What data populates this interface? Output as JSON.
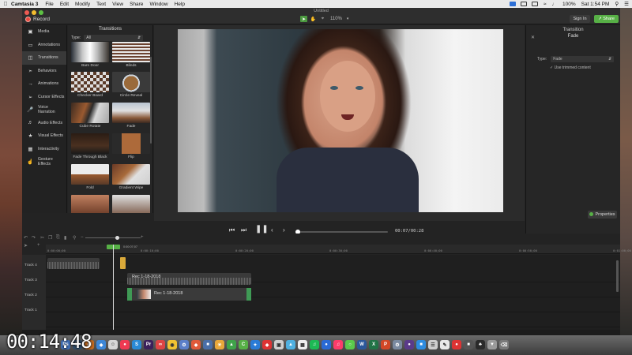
{
  "menubar": {
    "app_name": "Camtasia 3",
    "items": [
      "File",
      "Edit",
      "Modify",
      "Text",
      "View",
      "Share",
      "Window",
      "Help"
    ],
    "clock": "Sat 1:54 PM",
    "battery": "100%"
  },
  "window": {
    "title": "Untitled",
    "record_label": "Record",
    "zoom": "110%",
    "signin_label": "Sign In",
    "share_label": "Share"
  },
  "sidebar": {
    "items": [
      {
        "label": "Media",
        "icon": "film-icon"
      },
      {
        "label": "Annotations",
        "icon": "annotation-icon"
      },
      {
        "label": "Transitions",
        "icon": "transition-icon"
      },
      {
        "label": "Behaviors",
        "icon": "behavior-icon"
      },
      {
        "label": "Animations",
        "icon": "animation-icon"
      },
      {
        "label": "Cursor Effects",
        "icon": "cursor-icon"
      },
      {
        "label": "Voice Narration",
        "icon": "microphone-icon"
      },
      {
        "label": "Audio Effects",
        "icon": "speaker-icon"
      },
      {
        "label": "Visual Effects",
        "icon": "visual-effects-icon"
      },
      {
        "label": "Interactivity",
        "icon": "interactivity-icon"
      },
      {
        "label": "Gesture Effects",
        "icon": "hand-icon"
      }
    ],
    "active_index": 2
  },
  "transitions_panel": {
    "title": "Transitions",
    "type_label": "Type:",
    "type_value": "All",
    "items": [
      "Barn Door",
      "Blinds",
      "Checker Board",
      "Circle Reveal",
      "Cube Rotate",
      "Fade",
      "Fade Through Black",
      "Flip",
      "Fold",
      "Gradient Wipe"
    ]
  },
  "properties": {
    "header": "Transition",
    "name": "Fade",
    "type_label": "Type:",
    "type_value": "Fade",
    "checkbox_label": "Use trimmed content",
    "button_label": "Properties"
  },
  "playback": {
    "timecode": "00:07/00:28",
    "progress": 0.02
  },
  "timeline": {
    "ruler_ticks": [
      "0:00:00;00",
      "0:00:10;00",
      "0:00:20;00",
      "0:00:30;00",
      "0:00:40;00",
      "0:00:50;00",
      "0:01:00;00"
    ],
    "playhead_timecode": "0:00:07;07",
    "tracks": [
      "Track 4",
      "Track 3",
      "Track 2",
      "Track 1"
    ],
    "clip_audio_label": "Rec 1-18-2018",
    "clip_video_label": "Rec 1-18-2018"
  },
  "overlay": {
    "timer": "00:14:48"
  },
  "colors": {
    "accent_green": "#57b046",
    "record_red": "#e94a3f",
    "transition_yellow": "#d9a93a"
  }
}
